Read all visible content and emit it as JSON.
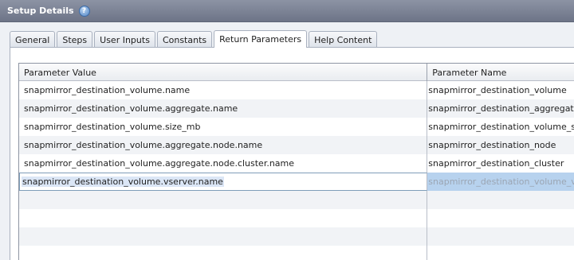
{
  "window": {
    "title": "Setup Details",
    "help_icon": "question-mark"
  },
  "tabs": [
    {
      "label": "General",
      "active": false
    },
    {
      "label": "Steps",
      "active": false
    },
    {
      "label": "User Inputs",
      "active": false
    },
    {
      "label": "Constants",
      "active": false
    },
    {
      "label": "Return Parameters",
      "active": true
    },
    {
      "label": "Help Content",
      "active": false
    }
  ],
  "table": {
    "columns": [
      "Parameter Value",
      "Parameter Name"
    ],
    "rows": [
      {
        "value": "snapmirror_destination_volume.name",
        "name": "snapmirror_destination_volume"
      },
      {
        "value": "snapmirror_destination_volume.aggregate.name",
        "name": "snapmirror_destination_aggregate"
      },
      {
        "value": "snapmirror_destination_volume.size_mb",
        "name": "snapmirror_destination_volume_size_mb"
      },
      {
        "value": "snapmirror_destination_volume.aggregate.node.name",
        "name": "snapmirror_destination_node"
      },
      {
        "value": "snapmirror_destination_volume.aggregate.node.cluster.name",
        "name": "snapmirror_destination_cluster"
      }
    ],
    "editing_row": {
      "value": "snapmirror_destination_volume.vserver.name",
      "name": "snapmirror_destination_volume_vserver"
    }
  }
}
